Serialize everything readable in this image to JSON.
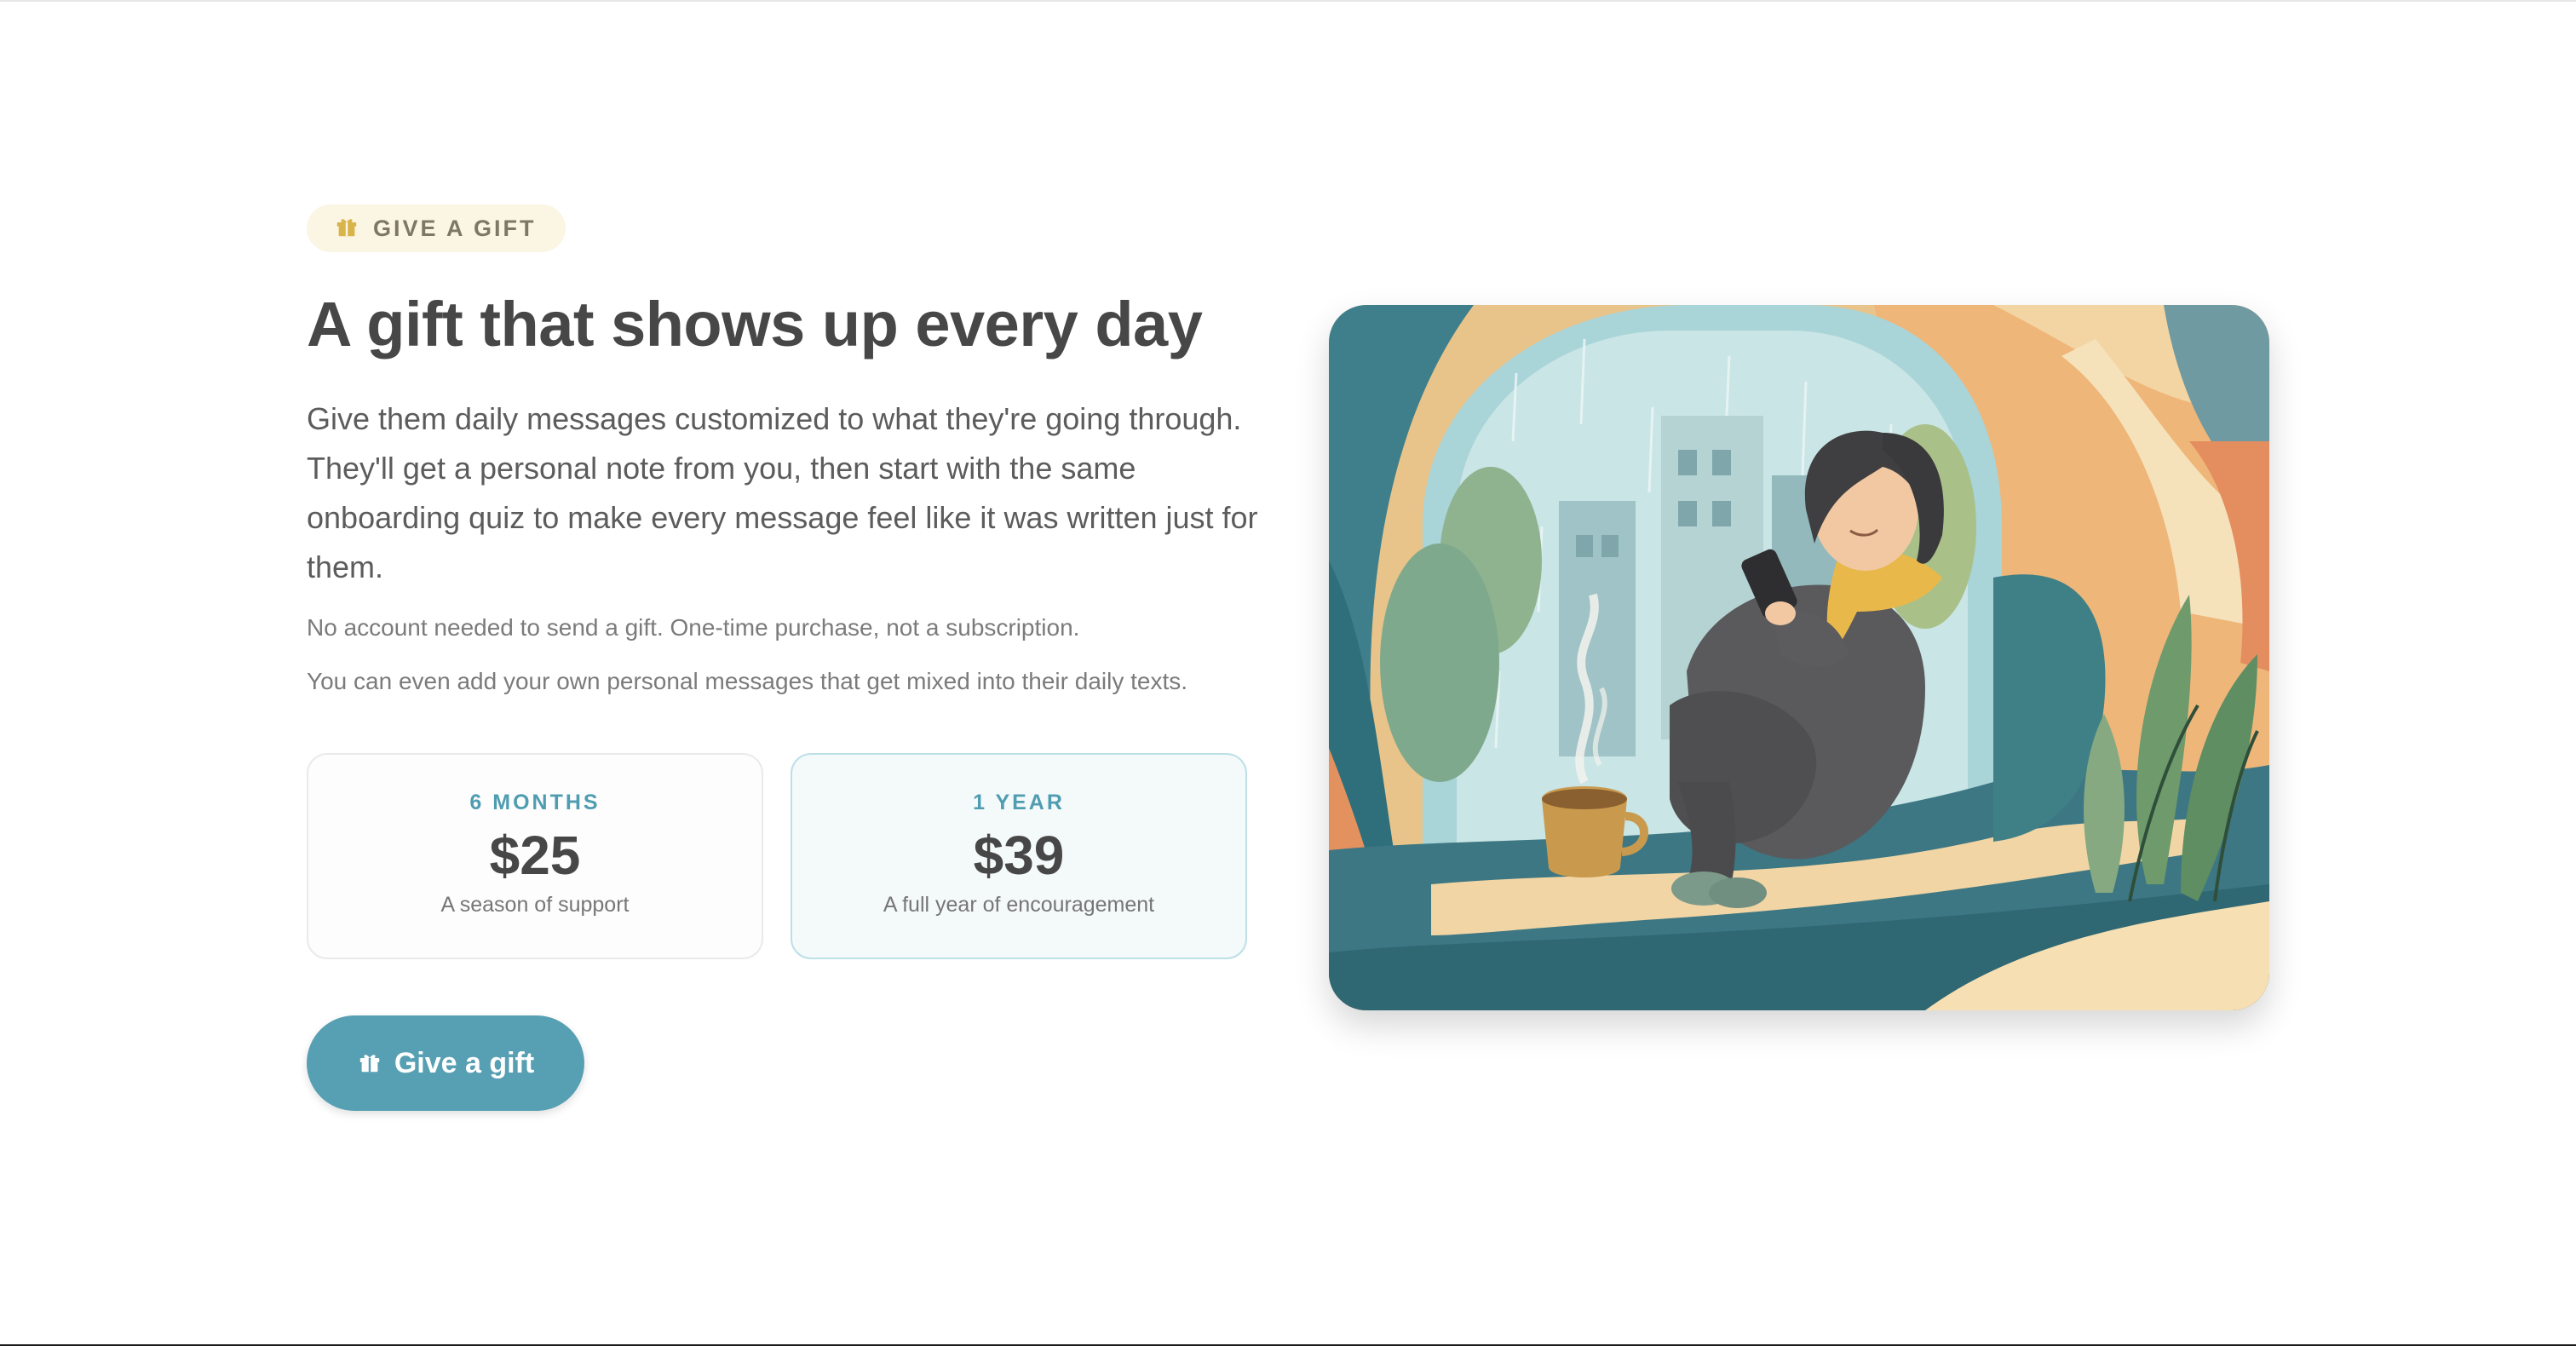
{
  "badge": {
    "label": "GIVE A GIFT",
    "icon": "gift-icon"
  },
  "hero": {
    "title": "A gift that shows up every day",
    "lead": "Give them daily messages customized to what they're going through. They'll get a personal note from you, then start with the same onboarding quiz to make every message feel like it was written just for them.",
    "note_1": "No account needed to send a gift. One-time purchase, not a subscription.",
    "note_2": "You can even add your own personal messages that get mixed into their daily texts."
  },
  "plans": [
    {
      "label": "6 MONTHS",
      "price": "$25",
      "description": "A season of support",
      "selected": false
    },
    {
      "label": "1 YEAR",
      "price": "$39",
      "description": "A full year of encouragement",
      "selected": true
    }
  ],
  "cta": {
    "label": "Give a gift",
    "icon": "gift-icon"
  },
  "colors": {
    "accent": "#57a0b3",
    "badge_bg": "#fbf5e4",
    "gift_icon": "#d9b44a",
    "heading": "#474747"
  }
}
